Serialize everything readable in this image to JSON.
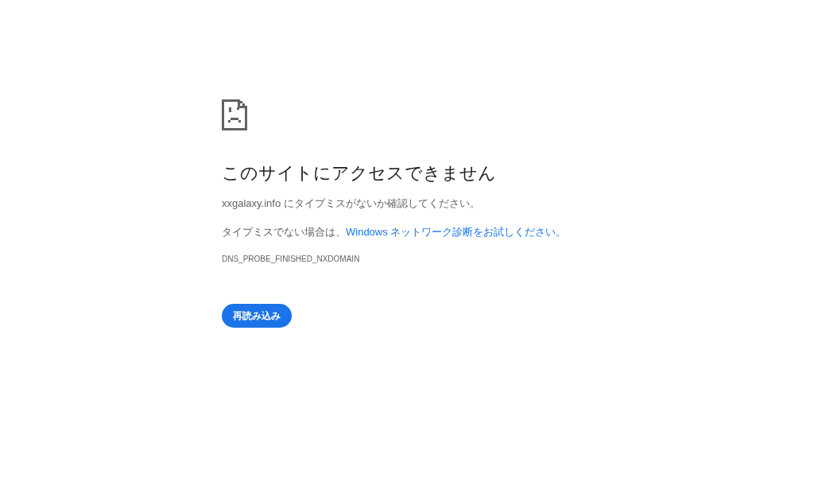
{
  "title": "このサイトにアクセスできません",
  "message": "xxgalaxy.info にタイプミスがないか確認してください。",
  "suggestion": {
    "text": "タイプミスでない場合は、",
    "link": "Windows ネットワーク診断をお試しください。"
  },
  "error_code": "DNS_PROBE_FINISHED_NXDOMAIN",
  "buttons": [
    {
      "label": "再読み込み"
    }
  ]
}
